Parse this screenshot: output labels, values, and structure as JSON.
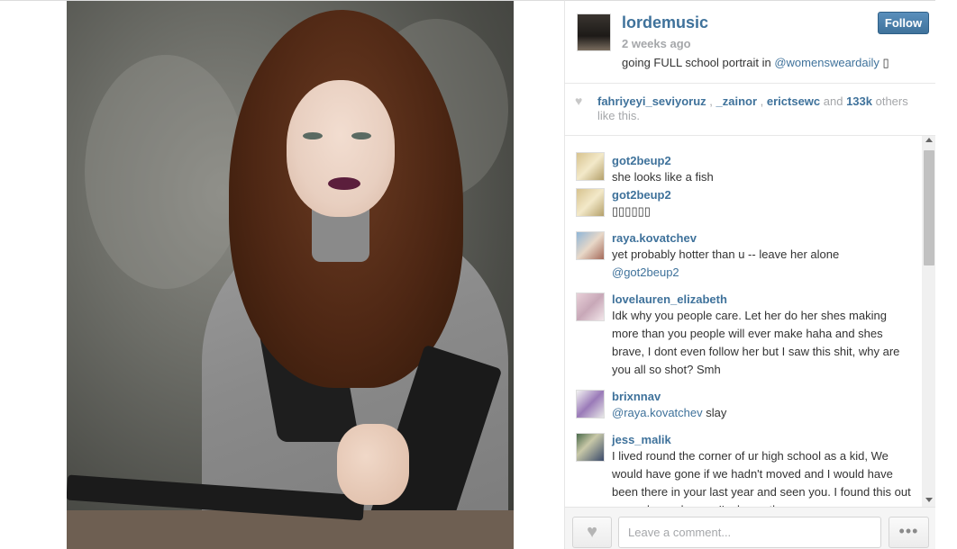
{
  "post": {
    "owner": "lordemusic",
    "time": "2 weeks ago",
    "caption_text": "going FULL school portrait in",
    "caption_mention": "@womensweardaily",
    "caption_trail": "▯",
    "follow_label": "Follow"
  },
  "likes": {
    "user1": "fahriyeyi_seviyoruz",
    "sep1": " , ",
    "user2": "_zainor",
    "sep2": " , ",
    "user3": "erictsewc",
    "and": " and ",
    "count": "133k",
    "others": " others like this."
  },
  "comments": [
    {
      "user": "got2beup2",
      "text": "she looks like a fish",
      "mention": ""
    },
    {
      "user": "got2beup2",
      "text": "▯▯▯▯▯▯",
      "mention": ""
    },
    {
      "user": "raya.kovatchev",
      "text": "yet probably hotter than u -- leave her alone",
      "mention": "@got2beup2"
    },
    {
      "user": "lovelauren_elizabeth",
      "text": "Idk why you people care. Let her do her shes making more than you people will ever make haha and shes brave, I dont even follow her but I saw this shit, why are you all so shot? Smh",
      "mention": ""
    },
    {
      "user": "brixnnav",
      "text": " slay",
      "mention": "@raya.kovatchev"
    },
    {
      "user": "jess_malik",
      "text": "I lived round the corner of ur high school as a kid, We would have gone if we hadn't moved and I would have been there in your last year and seen you. I found this out a couple weeks ago I'm honestly very",
      "mention": ""
    }
  ],
  "footer": {
    "comment_placeholder": "Leave a comment...",
    "like_icon": "heart-icon",
    "more_label": "•••"
  },
  "icons": {
    "likes": "heart-icon",
    "more": "ellipsis-icon"
  },
  "colors": {
    "link": "#3f729b",
    "muted": "#a5a7aa",
    "follow": "#3f729b"
  }
}
